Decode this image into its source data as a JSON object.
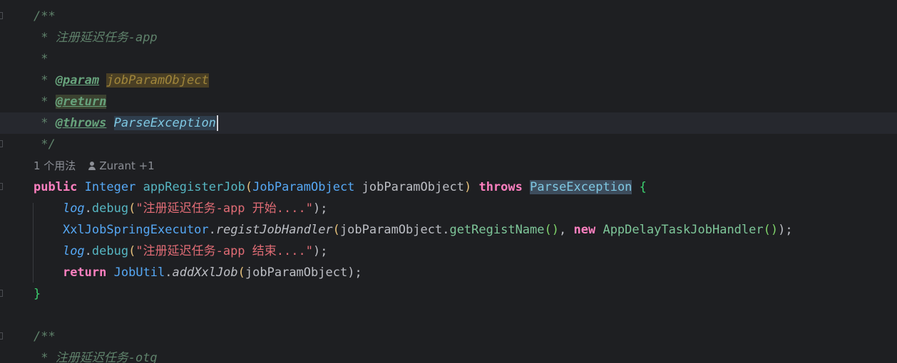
{
  "editor": {
    "lines": {
      "l1": {
        "doc_open": "/**"
      },
      "l2": {
        "star": " * ",
        "text": "注册延迟任务-app"
      },
      "l3": {
        "star": " *"
      },
      "l4": {
        "star": " * ",
        "tag": "@param",
        "name": "jobParamObject"
      },
      "l5": {
        "star": " * ",
        "tag": "@return"
      },
      "l6": {
        "star": " * ",
        "tag": "@throws",
        "name": "ParseException"
      },
      "l7": {
        "close": " */"
      },
      "l8": {
        "usages": "1 个用法",
        "author": "Zurant +1"
      },
      "l9": {
        "kw_public": "public",
        "type_return": "Integer",
        "method": "appRegisterJob",
        "paren_open": "(",
        "param_type": "JobParamObject",
        "param_name": " jobParamObject",
        "paren_close": ")",
        "kw_throws": "throws",
        "exc": "ParseException",
        "brace": "{"
      },
      "l10": {
        "field": "log",
        "dot": ".",
        "call": "debug",
        "po": "(",
        "str": "\"注册延迟任务-app 开始....\"",
        "pc": ");"
      },
      "l11": {
        "cls": "XxlJobSpringExecutor",
        "dot": ".",
        "call": "registJobHandler",
        "po": "(",
        "arg": "jobParamObject.",
        "getter": "getRegistName",
        "gpar": "()",
        "comma": ", ",
        "kw_new": "new",
        "ctor": "AppDelayTaskJobHandler",
        "cpar": "()",
        "pc": ");"
      },
      "l12": {
        "field": "log",
        "dot": ".",
        "call": "debug",
        "po": "(",
        "str": "\"注册延迟任务-app 结束....\"",
        "pc": ");"
      },
      "l13": {
        "kw_return": "return",
        "cls": "JobUtil",
        "dot": ".",
        "call": "addXxlJob",
        "po": "(",
        "arg": "jobParamObject",
        "pc": ");"
      },
      "l14": {
        "brace": "}"
      },
      "l16": {
        "doc_open": "/**"
      },
      "l17": {
        "star": " * ",
        "text": "注册延迟任务-otg"
      }
    }
  }
}
